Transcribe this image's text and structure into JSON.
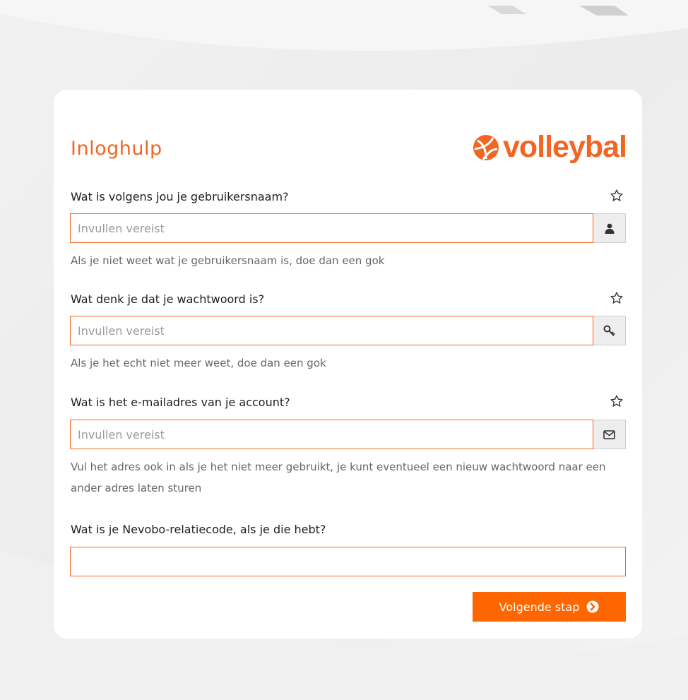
{
  "page": {
    "title": "Inloghulp",
    "logo_text": "volleybal"
  },
  "form": {
    "username": {
      "question": "Wat is volgens jou je gebruikersnaam?",
      "placeholder": "Invullen vereist",
      "value": "",
      "hint": "Als je niet weet wat je gebruikersnaam is, doe dan een gok",
      "addon_icon": "user-icon"
    },
    "password": {
      "question": "Wat denk je dat je wachtwoord is?",
      "placeholder": "Invullen vereist",
      "value": "",
      "hint": "Als je het echt niet meer weet, doe dan een gok",
      "addon_icon": "key-icon"
    },
    "email": {
      "question": "Wat is het e-mailadres van je account?",
      "placeholder": "Invullen vereist",
      "value": "",
      "hint": "Vul het adres ook in als je het niet meer gebruikt, je kunt eventueel een nieuw wachtwoord naar een ander adres laten sturen",
      "addon_icon": "envelope-icon"
    },
    "relatiecode": {
      "question": "Wat is je Nevobo-relatiecode, als je die hebt?",
      "placeholder": "",
      "value": ""
    }
  },
  "actions": {
    "next_label": "Volgende stap",
    "next_icon": "arrow-circle-right-icon"
  },
  "colors": {
    "accent": "#f26522",
    "button": "#ff6600",
    "background": "#eeeeee",
    "card": "#ffffff"
  }
}
